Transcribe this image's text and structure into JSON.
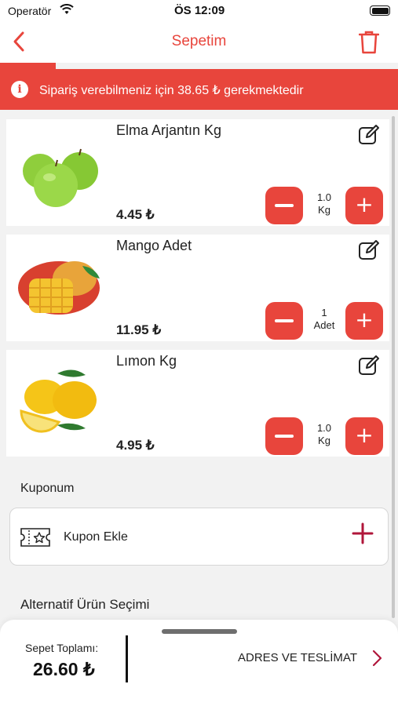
{
  "status_bar": {
    "carrier": "Operatör",
    "time": "ÖS 12:09"
  },
  "header": {
    "title": "Sepetim"
  },
  "progress": {
    "fraction": 0.14
  },
  "alert": {
    "message": "Sipariş verebilmeniz için 38.65 ₺ gerekmektedir"
  },
  "cart": {
    "items": [
      {
        "name": "Elma Arjantın Kg",
        "price": "4.45 ₺",
        "qty": "1.0",
        "unit": "Kg",
        "image": "green-apples"
      },
      {
        "name": "Mango Adet",
        "price": "11.95 ₺",
        "qty": "1",
        "unit": "Adet",
        "image": "mango"
      },
      {
        "name": "Lımon Kg",
        "price": "4.95 ₺",
        "qty": "1.0",
        "unit": "Kg",
        "image": "lemons"
      }
    ]
  },
  "coupon": {
    "section_title": "Kuponum",
    "add_label": "Kupon Ekle"
  },
  "alternative": {
    "section_title": "Alternatif Ürün Seçimi"
  },
  "footer": {
    "total_label": "Sepet Toplamı:",
    "total_value": "26.60 ₺",
    "checkout_label": "ADRES VE TESLİMAT"
  },
  "colors": {
    "accent": "#e8453c",
    "plus_icon": "#b0163a"
  }
}
